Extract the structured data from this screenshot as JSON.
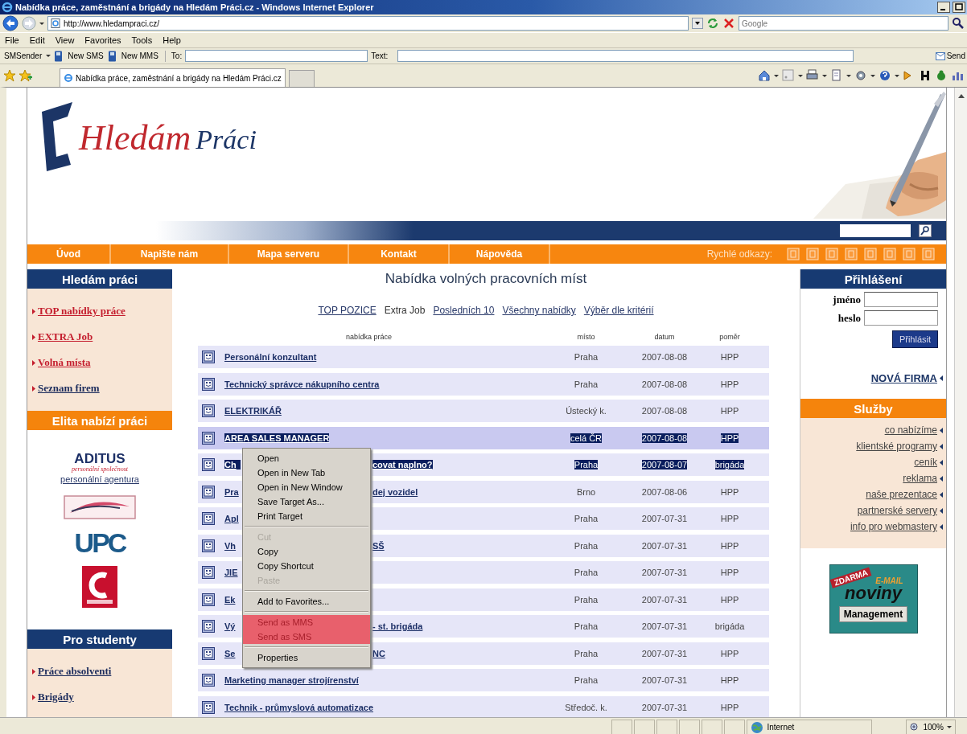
{
  "window": {
    "title": "Nabídka práce, zaměstnání a brigády na Hledám Práci.cz - Windows Internet Explorer"
  },
  "address_bar": {
    "url": "http://www.hledampraci.cz/",
    "search_placeholder": "Google"
  },
  "menu_bar": [
    "File",
    "Edit",
    "View",
    "Favorites",
    "Tools",
    "Help"
  ],
  "sms_toolbar": {
    "title": "SMSender",
    "buttons": [
      "New SMS",
      "New MMS"
    ],
    "to_label": "To:",
    "text_label": "Text:",
    "send": "Send"
  },
  "tabs": [
    {
      "label": "Nabídka práce, zaměstnání a brigády na Hledám Práci.cz",
      "selected": true
    }
  ],
  "site": {
    "logo": {
      "first": "Hledám",
      "second": "Práci"
    },
    "nav": [
      "Úvod",
      "Napište nám",
      "Mapa serveru",
      "Kontakt",
      "Nápověda"
    ],
    "quick_links_label": "Rychlé odkazy:",
    "left_sidebar": [
      {
        "kind": "links",
        "title": "Hledám práci",
        "color": "#173a72",
        "links": [
          {
            "label": "TOP nabídky práce",
            "color": "#c41e2e"
          },
          {
            "label": "EXTRA Job",
            "color": "#c41e2e"
          },
          {
            "label": "Volná místa",
            "color": "#c41e2e"
          },
          {
            "label": "Seznam firem",
            "color": "#1b2b5c"
          }
        ]
      },
      {
        "kind": "logos",
        "title": "Elita nabízí práci",
        "color": "#f5840c",
        "logo_name": "ADITUS",
        "logo_tagline": "personální společnost",
        "logo_link": "personální agentura",
        "brand": "UPC"
      },
      {
        "kind": "links",
        "title": "Pro studenty",
        "color": "#173a72",
        "links": [
          {
            "label": "Práce absolventi",
            "color": "#1b2b5c"
          },
          {
            "label": "Brigády",
            "color": "#1b2b5c"
          }
        ]
      }
    ],
    "heading": "Nabídka volných pracovních míst",
    "list_tabs": [
      {
        "label": "TOP POZICE",
        "selected": false
      },
      {
        "label": "Extra Job",
        "selected": true
      },
      {
        "label": "Posledních 10",
        "selected": false
      },
      {
        "label": "Všechny nabídky",
        "selected": false
      },
      {
        "label": "Výběr dle kritérií",
        "selected": false
      }
    ],
    "table": {
      "columns": [
        "nabídka práce",
        "místo",
        "datum",
        "poměr"
      ],
      "rows": [
        {
          "title": "Personální konzultant",
          "place": "Praha",
          "date": "2007-08-08",
          "type": "HPP",
          "highlighted": false,
          "selected": false
        },
        {
          "title": "Technický správce nákupního centra",
          "place": "Praha",
          "date": "2007-08-08",
          "type": "HPP",
          "highlighted": false,
          "selected": false
        },
        {
          "title": "ELEKTRIKÁŘ",
          "place": "Ústecký k.",
          "date": "2007-08-08",
          "type": "HPP",
          "highlighted": false,
          "selected": false
        },
        {
          "title": "AREA SALES MANAGER",
          "place": "celá ČR",
          "date": "2007-08-08",
          "type": "HPP",
          "highlighted": true,
          "selected": true
        },
        {
          "title": "Ch",
          "title_end": "covat naplno?",
          "place": "Praha",
          "date": "2007-08-07",
          "type": "brigáda",
          "highlighted": false,
          "selected": true
        },
        {
          "title": "Pra",
          "title_end": "dej vozidel",
          "place": "Brno",
          "date": "2007-08-06",
          "type": "HPP",
          "highlighted": false,
          "selected": false
        },
        {
          "title": "Apl",
          "place": "Praha",
          "date": "2007-07-31",
          "type": "HPP",
          "highlighted": false,
          "selected": false
        },
        {
          "title": "Vh",
          "title_end": "SŠ",
          "place": "Praha",
          "date": "2007-07-31",
          "type": "HPP",
          "highlighted": false,
          "selected": false
        },
        {
          "title": "JIE",
          "place": "Praha",
          "date": "2007-07-31",
          "type": "HPP",
          "highlighted": false,
          "selected": false
        },
        {
          "title": "Ek",
          "place": "Praha",
          "date": "2007-07-31",
          "type": "HPP",
          "highlighted": false,
          "selected": false
        },
        {
          "title": "Vý",
          "title_end": "- st. brigáda",
          "place": "Praha",
          "date": "2007-07-31",
          "type": "brigáda",
          "highlighted": false,
          "selected": false
        },
        {
          "title": "Se",
          "title_end": "NC",
          "place": "Praha",
          "date": "2007-07-31",
          "type": "HPP",
          "highlighted": false,
          "selected": false
        },
        {
          "title": "Marketing manager strojírenství",
          "place": "Praha",
          "date": "2007-07-31",
          "type": "HPP",
          "highlighted": false,
          "selected": false
        },
        {
          "title": "Technik - průmyslová automatizace",
          "place": "Středoč. k.",
          "date": "2007-07-31",
          "type": "HPP",
          "highlighted": false,
          "selected": false
        }
      ]
    },
    "context_menu": [
      {
        "kind": "item",
        "label": "Open",
        "disabled": false,
        "highlighted": false
      },
      {
        "kind": "item",
        "label": "Open in New Tab",
        "disabled": false,
        "highlighted": false
      },
      {
        "kind": "item",
        "label": "Open in New Window",
        "disabled": false,
        "highlighted": false
      },
      {
        "kind": "item",
        "label": "Save Target As...",
        "disabled": false,
        "highlighted": false
      },
      {
        "kind": "item",
        "label": "Print Target",
        "disabled": false,
        "highlighted": false
      },
      {
        "kind": "separator"
      },
      {
        "kind": "item",
        "label": "Cut",
        "disabled": true,
        "highlighted": false
      },
      {
        "kind": "item",
        "label": "Copy",
        "disabled": false,
        "highlighted": false
      },
      {
        "kind": "item",
        "label": "Copy Shortcut",
        "disabled": false,
        "highlighted": false
      },
      {
        "kind": "item",
        "label": "Paste",
        "disabled": true,
        "highlighted": false
      },
      {
        "kind": "separator"
      },
      {
        "kind": "item",
        "label": "Add to Favorites...",
        "disabled": false,
        "highlighted": false
      },
      {
        "kind": "separator"
      },
      {
        "kind": "item",
        "label": "Send as MMS",
        "disabled": false,
        "highlighted": true
      },
      {
        "kind": "item",
        "label": "Send as SMS",
        "disabled": false,
        "highlighted": true
      },
      {
        "kind": "separator"
      },
      {
        "kind": "item",
        "label": "Properties",
        "disabled": false,
        "highlighted": false
      }
    ],
    "login": {
      "title": "Přihlášení",
      "username_label": "jméno",
      "password_label": "heslo",
      "submit": "Přihlásit",
      "new_company": "NOVÁ FIRMA"
    },
    "services": {
      "title": "Služby",
      "links": [
        "co nabízíme",
        "klientské programy",
        "ceník",
        "reklama",
        "naše prezentace",
        "partnerské servery",
        "info pro webmastery"
      ]
    },
    "banner": {
      "ribbon": "ZDARMA",
      "tag": "E-MAIL",
      "name": "noviny",
      "button": "Management"
    }
  },
  "status_bar": {
    "zone": "Internet",
    "zoom": "100%"
  }
}
